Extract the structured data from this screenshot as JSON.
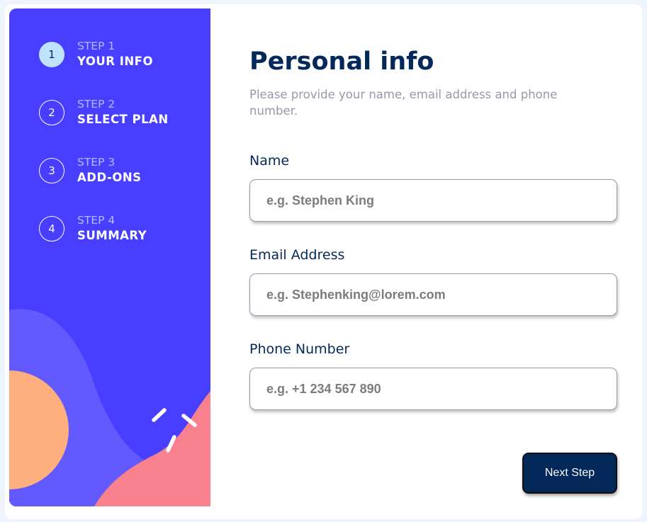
{
  "sidebar": {
    "steps": [
      {
        "number": "1",
        "label": "STEP 1",
        "title": "YOUR INFO",
        "active": true
      },
      {
        "number": "2",
        "label": "STEP 2",
        "title": "SELECT PLAN",
        "active": false
      },
      {
        "number": "3",
        "label": "STEP 3",
        "title": "ADD-ONS",
        "active": false
      },
      {
        "number": "4",
        "label": "STEP 4",
        "title": "SUMMARY",
        "active": false
      }
    ]
  },
  "form": {
    "title": "Personal info",
    "subtitle": "Please provide your name, email address and phone number.",
    "fields": {
      "name": {
        "label": "Name",
        "placeholder": "e.g. Stephen King",
        "value": ""
      },
      "email": {
        "label": "Email Address",
        "placeholder": "e.g. Stephenking@lorem.com",
        "value": ""
      },
      "phone": {
        "label": "Phone Number",
        "placeholder": "e.g. +1 234 567 890",
        "value": ""
      }
    },
    "next_label": "Next Step"
  },
  "colors": {
    "sidebar_bg": "#483eff",
    "accent_dark": "#02295a",
    "active_step": "#bfe2fd",
    "muted_text": "#9699ab",
    "blob_orange": "#ffaf7e",
    "blob_pink": "#f9818e",
    "blob_violet": "#6259ff"
  }
}
